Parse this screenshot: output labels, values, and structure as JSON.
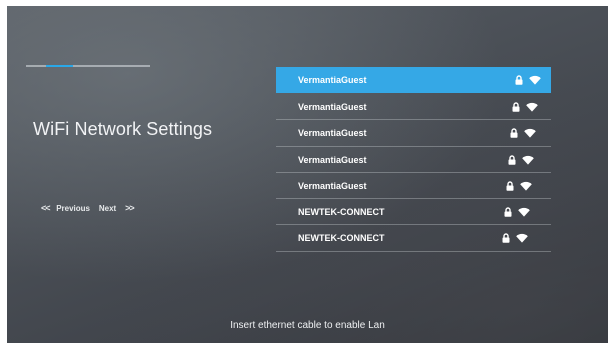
{
  "header": {
    "title": "WiFi Network Settings",
    "progress_fraction": 0.22
  },
  "pager": {
    "prev_glyph": "<<",
    "prev_label": "Previous",
    "next_label": "Next",
    "next_glyph": ">>"
  },
  "networks": [
    {
      "ssid": "VermantiaGuest",
      "secured": true,
      "signal": "full",
      "selected": true
    },
    {
      "ssid": "VermantiaGuest",
      "secured": true,
      "signal": "full",
      "selected": false
    },
    {
      "ssid": "VermantiaGuest",
      "secured": true,
      "signal": "full",
      "selected": false
    },
    {
      "ssid": "VermantiaGuest",
      "secured": true,
      "signal": "full",
      "selected": false
    },
    {
      "ssid": "VermantiaGuest",
      "secured": true,
      "signal": "full",
      "selected": false
    },
    {
      "ssid": "NEWTEK-CONNECT",
      "secured": true,
      "signal": "full",
      "selected": false
    },
    {
      "ssid": "NEWTEK-CONNECT",
      "secured": true,
      "signal": "full",
      "selected": false
    }
  ],
  "icons": {
    "lock": "lock-icon",
    "signal": "wifi-signal-icon",
    "prev": "chevron-double-left-icon",
    "next": "chevron-double-right-icon"
  },
  "footer": {
    "message": "Insert ethernet cable to enable Lan"
  },
  "colors": {
    "accent": "#35a8e6",
    "progress_accent": "#2aa8e8",
    "text": "#f2f3f5",
    "background": "#4a4f56"
  }
}
